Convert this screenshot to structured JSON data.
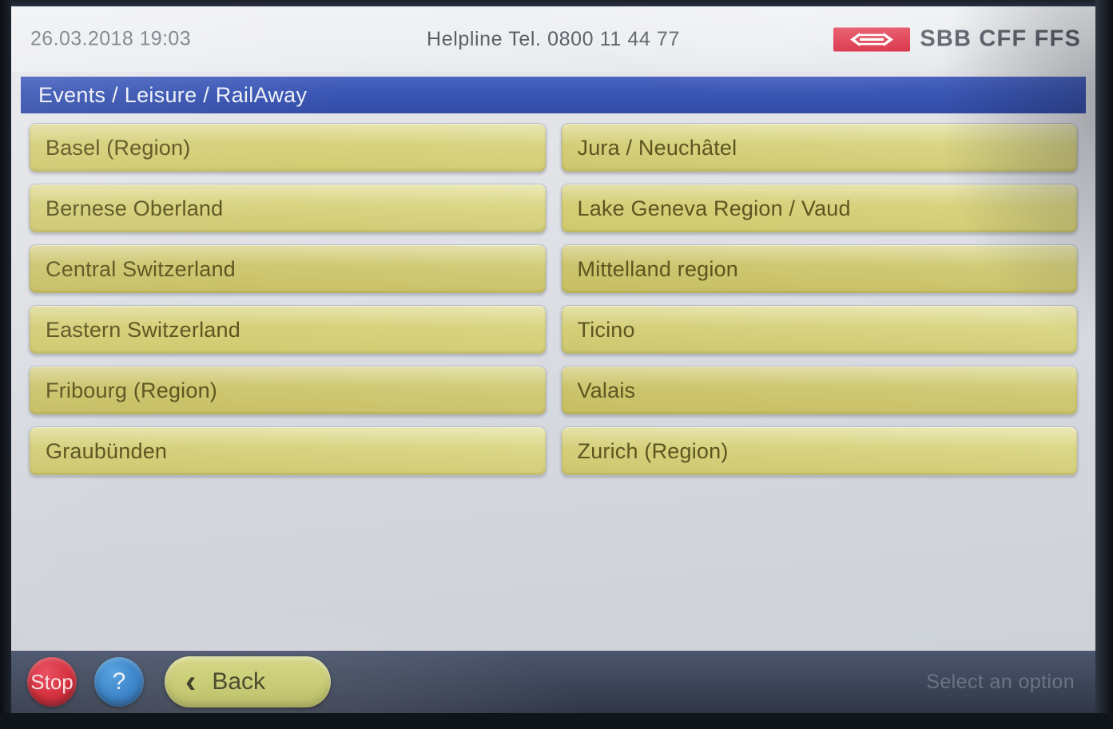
{
  "header": {
    "datetime": "26.03.2018 19:03",
    "helpline": "Helpline  Tel. 0800 11 44 77",
    "brand": "SBB CFF FFS",
    "brand_mark_color": "#d8293f"
  },
  "titlebar": {
    "breadcrumb": "Events / Leisure / RailAway",
    "color": "#3a56b4"
  },
  "options": {
    "left": [
      {
        "label": "Basel (Region)"
      },
      {
        "label": "Bernese Oberland"
      },
      {
        "label": "Central Switzerland"
      },
      {
        "label": "Eastern Switzerland"
      },
      {
        "label": "Fribourg (Region)"
      },
      {
        "label": "Graubünden"
      }
    ],
    "right": [
      {
        "label": "Jura / Neuchâtel"
      },
      {
        "label": "Lake Geneva Region / Vaud"
      },
      {
        "label": "Mittelland region"
      },
      {
        "label": "Ticino"
      },
      {
        "label": "Valais"
      },
      {
        "label": "Zurich (Region)"
      }
    ],
    "button_color": "#d4cd74",
    "button_text_color": "#5d5520"
  },
  "toolbar": {
    "stop_label": "Stop",
    "help_label": "?",
    "back_chevron": "‹",
    "back_label": "Back",
    "hint": "Select an option",
    "stop_color": "#d0202f",
    "help_color": "#2a78c2",
    "back_color": "#c5c86a"
  }
}
